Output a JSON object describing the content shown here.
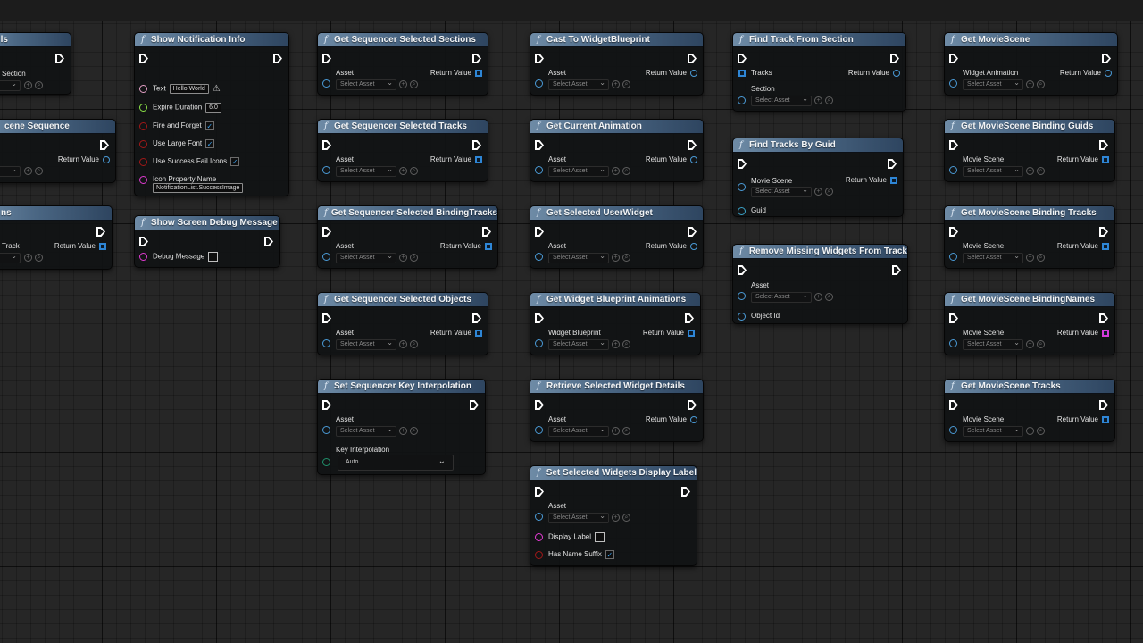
{
  "nodes": {
    "partial_sections": {
      "title": "ls",
      "pin": "Section",
      "select": "lect"
    },
    "partial_sequence": {
      "title": "cene Sequence",
      "ret": "Return Value",
      "select": "lect"
    },
    "partial_track": {
      "title": "ns",
      "pin": "Track",
      "ret": "Return Value",
      "select": "lect"
    },
    "show_notification": {
      "title": "Show Notification Info",
      "text_label": "Text",
      "text_value": "Hello World",
      "expire_label": "Expire Duration",
      "expire_value": "6.0",
      "fire_label": "Fire and Forget",
      "fire_checked": "✓",
      "large_font_label": "Use Large Font",
      "large_font_checked": "✓",
      "success_icons_label": "Use Success Fail Icons",
      "success_icons_checked": "✓",
      "icon_prop_label": "Icon Property Name",
      "icon_prop_value": "NotificationList.SuccessImage",
      "collapse_icon": "chevron-up"
    },
    "show_debug": {
      "title": "Show Screen Debug Message",
      "pin": "Debug Message"
    },
    "sel_sections": {
      "title": "Get Sequencer Selected Sections",
      "pin": "Asset",
      "ret": "Return Value",
      "select": "Select Asset"
    },
    "sel_tracks": {
      "title": "Get Sequencer Selected Tracks",
      "pin": "Asset",
      "ret": "Return Value",
      "select": "Select Asset"
    },
    "sel_binding_tracks": {
      "title": "Get Sequencer Selected BindingTracks",
      "pin": "Asset",
      "ret": "Return Value",
      "select": "Select Asset"
    },
    "sel_objects": {
      "title": "Get Sequencer Selected Objects",
      "pin": "Asset",
      "ret": "Return Value",
      "select": "Select Asset"
    },
    "set_key_interp": {
      "title": "Set Sequencer Key Interpolation",
      "pin": "Asset",
      "select": "Select Asset",
      "interp_label": "Key Interpolation",
      "interp_value": "Auto"
    },
    "cast_widget_bp": {
      "title": "Cast To WidgetBlueprint",
      "pin": "Asset",
      "ret": "Return Value",
      "select": "Select Asset"
    },
    "get_current_anim": {
      "title": "Get Current Animation",
      "pin": "Asset",
      "ret": "Return Value",
      "select": "Select Asset"
    },
    "get_sel_userwidget": {
      "title": "Get Selected UserWidget",
      "pin": "Asset",
      "ret": "Return Value",
      "select": "Select Asset"
    },
    "get_wbp_anims": {
      "title": "Get Widget Blueprint Animations",
      "pin": "Widget Blueprint",
      "ret": "Return Value",
      "select": "Select Asset"
    },
    "retrieve_widget_details": {
      "title": "Retrieve Selected Widget Details",
      "pin": "Asset",
      "ret": "Return Value",
      "select": "Select Asset"
    },
    "set_display_label": {
      "title": "Set Selected Widgets Display Label",
      "pin": "Asset",
      "select": "Select Asset",
      "display_label": "Display Label",
      "name_suffix_label": "Has Name Suffix",
      "name_suffix_checked": "✓"
    },
    "find_track_from_section": {
      "title": "Find Track From Section",
      "tracks_label": "Tracks",
      "ret": "Return Value",
      "section_label": "Section",
      "select": "Select Asset"
    },
    "find_tracks_by_guid": {
      "title": "Find Tracks By Guid",
      "pin": "Movie Scene",
      "ret": "Return Value",
      "select": "Select Asset",
      "guid_label": "Guid"
    },
    "remove_missing_widgets": {
      "title": "Remove Missing Widgets From Track",
      "pin": "Asset",
      "select": "Select Asset",
      "object_id_label": "Object Id"
    },
    "get_moviescene": {
      "title": "Get MovieScene",
      "pin": "Widget Animation",
      "ret": "Return Value",
      "select": "Select Asset"
    },
    "get_binding_guids": {
      "title": "Get MovieScene Binding Guids",
      "pin": "Movie Scene",
      "ret": "Return Value",
      "select": "Select Asset"
    },
    "get_binding_tracks": {
      "title": "Get MovieScene Binding Tracks",
      "pin": "Movie Scene",
      "ret": "Return Value",
      "select": "Select Asset"
    },
    "get_binding_names": {
      "title": "Get MovieScene BindingNames",
      "pin": "Movie Scene",
      "ret": "Return Value",
      "select": "Select Asset"
    },
    "get_ms_tracks": {
      "title": "Get MovieScene Tracks",
      "pin": "Movie Scene",
      "ret": "Return Value",
      "select": "Select Asset"
    }
  },
  "icons": {
    "function": "f",
    "search": "⌕",
    "use": "⊕"
  },
  "colors": {
    "header_start": "#6e8ba6",
    "header_end": "#2e4560",
    "object_pin": "#4a9ad6",
    "bool_pin": "#a11818",
    "string_pin": "#e13ad2",
    "float_pin": "#8be247"
  }
}
